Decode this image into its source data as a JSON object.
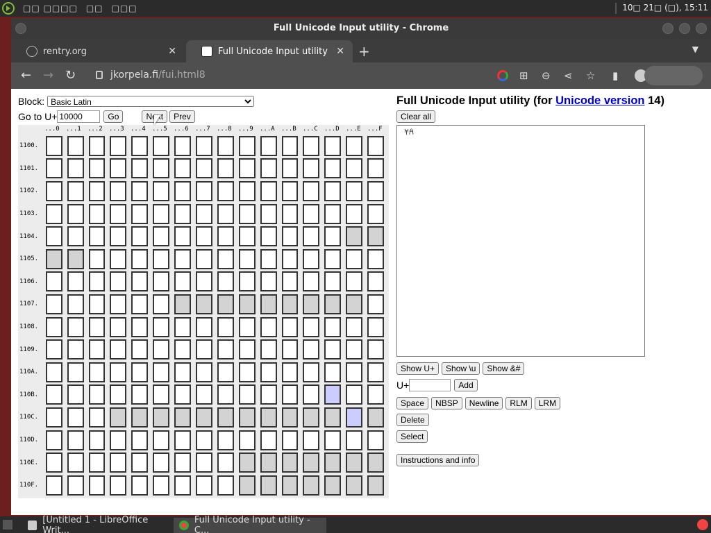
{
  "system_panel": {
    "menus": [
      "□□ □□□□",
      "□□",
      "□□□"
    ],
    "clock": "10□ 21□ (□), 15:11"
  },
  "window": {
    "title": "Full Unicode Input utility - Chrome",
    "tabs": [
      {
        "label": "rentry.org",
        "active": false
      },
      {
        "label": "Full Unicode Input utility",
        "active": true
      }
    ],
    "new_tab": "+",
    "url_host": "jkorpela.fi",
    "url_path": "/fui.html8"
  },
  "page": {
    "block_label": "Block:",
    "block_selected": "Basic Latin",
    "goto_label": "Go to U+",
    "goto_value": "10000",
    "go_button": "Go",
    "next_button": "Next",
    "prev_button": "Prev",
    "column_headers": [
      "...0",
      "...1",
      "...2",
      "...3",
      "...4",
      "...5",
      "...6",
      "...7",
      "...8",
      "...9",
      "...A",
      "...B",
      "...C",
      "...D",
      "...E",
      "...F"
    ],
    "rows": [
      {
        "label": "1100.",
        "cells": "wwwwwwwwwwwwwwww"
      },
      {
        "label": "1101.",
        "cells": "wwwwwwwwwwwwwwww"
      },
      {
        "label": "1102.",
        "cells": "wwwwwwwwwwwwwwww"
      },
      {
        "label": "1103.",
        "cells": "wwwwwwwwwwwwwwww"
      },
      {
        "label": "1104.",
        "cells": "wwwwwwwwwwwwwwgg"
      },
      {
        "label": "1105.",
        "cells": "ggwwwwwwwwwwwwww"
      },
      {
        "label": "1106.",
        "cells": "wwwwwwwwwwwwwwww"
      },
      {
        "label": "1107.",
        "cells": "wwwwwwgggggggggw"
      },
      {
        "label": "1108.",
        "cells": "wwwwwwwwwwwwwwww"
      },
      {
        "label": "1109.",
        "cells": "wwwwwwwwwwwwwwww"
      },
      {
        "label": "110A.",
        "cells": "wwwwwwwwwwwwwwww"
      },
      {
        "label": "110B.",
        "cells": "wwwwwwwwwwwwwpww"
      },
      {
        "label": "110C.",
        "cells": "wwwgggggggggggpgg"
      },
      {
        "label": "110D.",
        "cells": "wwwwwwwwwwwwwwww"
      },
      {
        "label": "110E.",
        "cells": "wwwwwwwwwggggggg"
      },
      {
        "label": "110F.",
        "cells": "wwwwwwwwwggggggg"
      }
    ],
    "heading_prefix": "Full Unicode Input utility (for ",
    "heading_link": "Unicode version",
    "heading_suffix": " 14)",
    "clear_all": "Clear all",
    "textarea_content": "𐀀𐀁",
    "show_u": "Show U+",
    "show_backslash_u": "Show \\u",
    "show_entity": "Show &#",
    "u_plus_label": "U+",
    "add_button": "Add",
    "space_button": "Space",
    "nbsp_button": "NBSP",
    "newline_button": "Newline",
    "rlm_button": "RLM",
    "lrm_button": "LRM",
    "delete_button": "Delete",
    "select_button": "Select",
    "instructions_button": "Instructions and info"
  },
  "taskbar": {
    "items": [
      {
        "label": "[Untitled 1 - LibreOffice Writ...",
        "active": false
      },
      {
        "label": "Full Unicode Input utility - C...",
        "active": true
      }
    ]
  }
}
